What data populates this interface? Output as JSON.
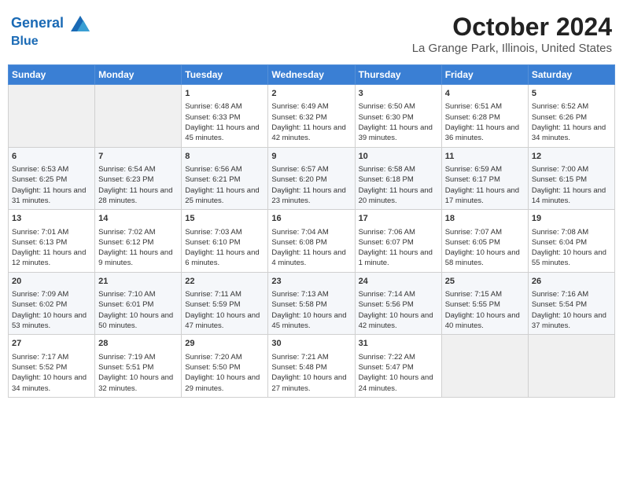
{
  "header": {
    "logo_line1": "General",
    "logo_line2": "Blue",
    "month": "October 2024",
    "location": "La Grange Park, Illinois, United States"
  },
  "weekdays": [
    "Sunday",
    "Monday",
    "Tuesday",
    "Wednesday",
    "Thursday",
    "Friday",
    "Saturday"
  ],
  "weeks": [
    [
      {
        "day": "",
        "info": ""
      },
      {
        "day": "",
        "info": ""
      },
      {
        "day": "1",
        "info": "Sunrise: 6:48 AM\nSunset: 6:33 PM\nDaylight: 11 hours and 45 minutes."
      },
      {
        "day": "2",
        "info": "Sunrise: 6:49 AM\nSunset: 6:32 PM\nDaylight: 11 hours and 42 minutes."
      },
      {
        "day": "3",
        "info": "Sunrise: 6:50 AM\nSunset: 6:30 PM\nDaylight: 11 hours and 39 minutes."
      },
      {
        "day": "4",
        "info": "Sunrise: 6:51 AM\nSunset: 6:28 PM\nDaylight: 11 hours and 36 minutes."
      },
      {
        "day": "5",
        "info": "Sunrise: 6:52 AM\nSunset: 6:26 PM\nDaylight: 11 hours and 34 minutes."
      }
    ],
    [
      {
        "day": "6",
        "info": "Sunrise: 6:53 AM\nSunset: 6:25 PM\nDaylight: 11 hours and 31 minutes."
      },
      {
        "day": "7",
        "info": "Sunrise: 6:54 AM\nSunset: 6:23 PM\nDaylight: 11 hours and 28 minutes."
      },
      {
        "day": "8",
        "info": "Sunrise: 6:56 AM\nSunset: 6:21 PM\nDaylight: 11 hours and 25 minutes."
      },
      {
        "day": "9",
        "info": "Sunrise: 6:57 AM\nSunset: 6:20 PM\nDaylight: 11 hours and 23 minutes."
      },
      {
        "day": "10",
        "info": "Sunrise: 6:58 AM\nSunset: 6:18 PM\nDaylight: 11 hours and 20 minutes."
      },
      {
        "day": "11",
        "info": "Sunrise: 6:59 AM\nSunset: 6:17 PM\nDaylight: 11 hours and 17 minutes."
      },
      {
        "day": "12",
        "info": "Sunrise: 7:00 AM\nSunset: 6:15 PM\nDaylight: 11 hours and 14 minutes."
      }
    ],
    [
      {
        "day": "13",
        "info": "Sunrise: 7:01 AM\nSunset: 6:13 PM\nDaylight: 11 hours and 12 minutes."
      },
      {
        "day": "14",
        "info": "Sunrise: 7:02 AM\nSunset: 6:12 PM\nDaylight: 11 hours and 9 minutes."
      },
      {
        "day": "15",
        "info": "Sunrise: 7:03 AM\nSunset: 6:10 PM\nDaylight: 11 hours and 6 minutes."
      },
      {
        "day": "16",
        "info": "Sunrise: 7:04 AM\nSunset: 6:08 PM\nDaylight: 11 hours and 4 minutes."
      },
      {
        "day": "17",
        "info": "Sunrise: 7:06 AM\nSunset: 6:07 PM\nDaylight: 11 hours and 1 minute."
      },
      {
        "day": "18",
        "info": "Sunrise: 7:07 AM\nSunset: 6:05 PM\nDaylight: 10 hours and 58 minutes."
      },
      {
        "day": "19",
        "info": "Sunrise: 7:08 AM\nSunset: 6:04 PM\nDaylight: 10 hours and 55 minutes."
      }
    ],
    [
      {
        "day": "20",
        "info": "Sunrise: 7:09 AM\nSunset: 6:02 PM\nDaylight: 10 hours and 53 minutes."
      },
      {
        "day": "21",
        "info": "Sunrise: 7:10 AM\nSunset: 6:01 PM\nDaylight: 10 hours and 50 minutes."
      },
      {
        "day": "22",
        "info": "Sunrise: 7:11 AM\nSunset: 5:59 PM\nDaylight: 10 hours and 47 minutes."
      },
      {
        "day": "23",
        "info": "Sunrise: 7:13 AM\nSunset: 5:58 PM\nDaylight: 10 hours and 45 minutes."
      },
      {
        "day": "24",
        "info": "Sunrise: 7:14 AM\nSunset: 5:56 PM\nDaylight: 10 hours and 42 minutes."
      },
      {
        "day": "25",
        "info": "Sunrise: 7:15 AM\nSunset: 5:55 PM\nDaylight: 10 hours and 40 minutes."
      },
      {
        "day": "26",
        "info": "Sunrise: 7:16 AM\nSunset: 5:54 PM\nDaylight: 10 hours and 37 minutes."
      }
    ],
    [
      {
        "day": "27",
        "info": "Sunrise: 7:17 AM\nSunset: 5:52 PM\nDaylight: 10 hours and 34 minutes."
      },
      {
        "day": "28",
        "info": "Sunrise: 7:19 AM\nSunset: 5:51 PM\nDaylight: 10 hours and 32 minutes."
      },
      {
        "day": "29",
        "info": "Sunrise: 7:20 AM\nSunset: 5:50 PM\nDaylight: 10 hours and 29 minutes."
      },
      {
        "day": "30",
        "info": "Sunrise: 7:21 AM\nSunset: 5:48 PM\nDaylight: 10 hours and 27 minutes."
      },
      {
        "day": "31",
        "info": "Sunrise: 7:22 AM\nSunset: 5:47 PM\nDaylight: 10 hours and 24 minutes."
      },
      {
        "day": "",
        "info": ""
      },
      {
        "day": "",
        "info": ""
      }
    ]
  ]
}
